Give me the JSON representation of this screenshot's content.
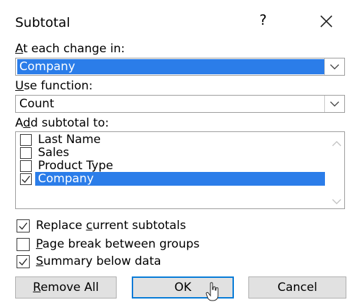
{
  "dialog": {
    "title": "Subtotal",
    "help_label": "?"
  },
  "change_in": {
    "label_underlined": "A",
    "label_rest": "t each change in:",
    "value": "Company"
  },
  "use_function": {
    "label_underlined": "U",
    "label_rest": "se function:",
    "value": "Count"
  },
  "add_subtotal": {
    "label_prefix": "A",
    "label_underlined": "d",
    "label_rest": "d subtotal to:",
    "items": [
      {
        "label": "Last Name",
        "checked": false,
        "selected": false
      },
      {
        "label": "Sales",
        "checked": false,
        "selected": false
      },
      {
        "label": "Product Type",
        "checked": false,
        "selected": false
      },
      {
        "label": "Company",
        "checked": true,
        "selected": true
      }
    ]
  },
  "options": {
    "replace": {
      "prefix": "Replace ",
      "underlined": "c",
      "rest": "urrent subtotals",
      "checked": true
    },
    "page_break": {
      "prefix": "",
      "underlined": "P",
      "rest": "age break between groups",
      "checked": false
    },
    "summary": {
      "prefix": "",
      "underlined": "S",
      "rest": "ummary below data",
      "checked": true
    }
  },
  "buttons": {
    "remove_all_underlined": "R",
    "remove_all_rest": "emove All",
    "ok": "OK",
    "cancel": "Cancel"
  },
  "colors": {
    "selection": "#2b7de9",
    "default_button_border": "#0078d7"
  }
}
